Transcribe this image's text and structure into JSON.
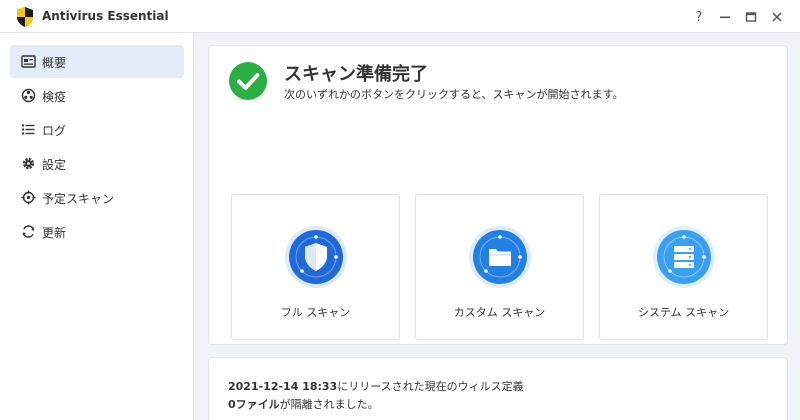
{
  "window": {
    "title": "Antivirus Essential",
    "help_symbol": "?"
  },
  "sidebar": {
    "items": [
      {
        "label": "概要",
        "icon": "overview-icon",
        "active": true
      },
      {
        "label": "検疫",
        "icon": "quarantine-icon",
        "active": false
      },
      {
        "label": "ログ",
        "icon": "log-list-icon",
        "active": false
      },
      {
        "label": "設定",
        "icon": "gear-icon",
        "active": false
      },
      {
        "label": "予定スキャン",
        "icon": "crosshair-icon",
        "active": false
      },
      {
        "label": "更新",
        "icon": "refresh-icon",
        "active": false
      }
    ]
  },
  "status": {
    "title": "スキャン準備完了",
    "description": "次のいずれかのボタンをクリックすると、スキャンが開始されます。",
    "icon": "check-circle-icon",
    "color": "#2bae43"
  },
  "scan_options": [
    {
      "label": "フル スキャン",
      "icon": "shield-icon",
      "color": "#1f6ad6"
    },
    {
      "label": "カスタム スキャン",
      "icon": "folder-icon",
      "color": "#2480e0"
    },
    {
      "label": "システム スキャン",
      "icon": "server-icon",
      "color": "#39a0f0"
    }
  ],
  "definitions": {
    "datetime": "2021-12-14 18:33",
    "release_text": "にリリースされた現在のウィルス定義",
    "quarantine_count": "0ファイル",
    "quarantine_text": "が隔離されました。"
  },
  "colors": {
    "accent": "#1f6ad6",
    "active_nav_bg": "#e3edf9",
    "app_bg": "#f0f3f7"
  }
}
